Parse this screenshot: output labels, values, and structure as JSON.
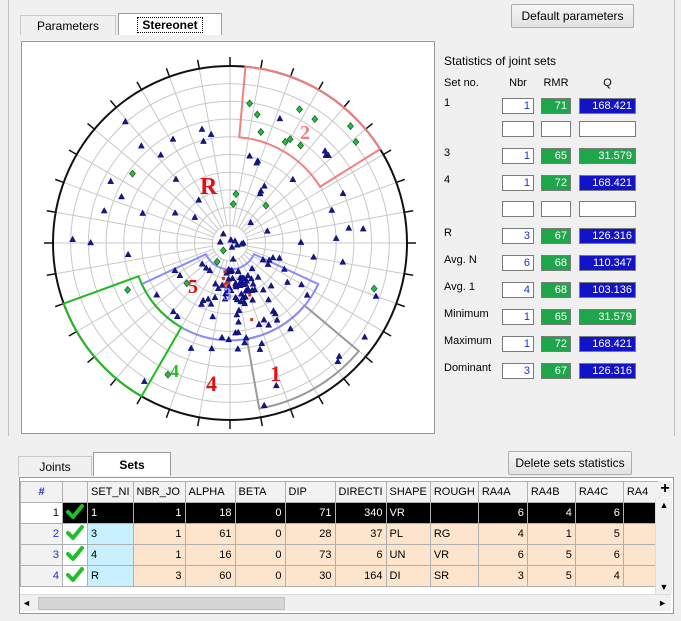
{
  "top_tabs": {
    "parameters": "Parameters",
    "stereonet": "Stereonet"
  },
  "default_button": "Default parameters",
  "stats": {
    "title": "Statistics of joint sets",
    "col_set": "Set no.",
    "col_nbr": "Nbr",
    "col_rmr": "RMR",
    "col_q": "Q",
    "rows": [
      {
        "label": "1",
        "nbr": "1",
        "rmr": "71",
        "q": "168.421",
        "qcolor": "blue"
      },
      {
        "label": "",
        "nbr": "",
        "rmr": "",
        "q": "",
        "qcolor": "empty"
      },
      {
        "label": "3",
        "nbr": "1",
        "rmr": "65",
        "q": "31.579",
        "qcolor": "green"
      },
      {
        "label": "4",
        "nbr": "1",
        "rmr": "72",
        "q": "168.421",
        "qcolor": "blue"
      },
      {
        "label": "",
        "nbr": "",
        "rmr": "",
        "q": "",
        "qcolor": "empty"
      },
      {
        "label": "R",
        "nbr": "3",
        "rmr": "67",
        "q": "126.316",
        "qcolor": "blue"
      },
      {
        "label": "Avg. N",
        "nbr": "6",
        "rmr": "68",
        "q": "110.347",
        "qcolor": "blue"
      },
      {
        "label": "Avg. 1",
        "nbr": "4",
        "rmr": "68",
        "q": "103.136",
        "qcolor": "blue"
      },
      {
        "label": "Minimum",
        "nbr": "1",
        "rmr": "65",
        "q": "31.579",
        "qcolor": "green"
      },
      {
        "label": "Maximum",
        "nbr": "1",
        "rmr": "72",
        "q": "168.421",
        "qcolor": "blue"
      },
      {
        "label": "Dominant",
        "nbr": "3",
        "rmr": "67",
        "q": "126.316",
        "qcolor": "blue"
      }
    ]
  },
  "stereonet": {
    "labels": {
      "set1": "1",
      "set2": "2",
      "set3": "3",
      "set3b": "5",
      "set4": "4",
      "set4b": "4",
      "random": "R"
    },
    "colors": {
      "set1": "#999999",
      "set2": "#f08080",
      "set3": "#8a8aff",
      "set4": "#22bb22",
      "label_red": "#e01010"
    }
  },
  "bottom_tabs": {
    "joints": "Joints",
    "sets": "Sets"
  },
  "delete_button": "Delete sets statistics",
  "grid": {
    "headers": [
      "#",
      "",
      "SET_NI",
      "NBR_JO",
      "ALPHA",
      "BETA",
      "DIP",
      "DIRECTI",
      "SHAPE",
      "ROUGH",
      "RA4A",
      "RA4B",
      "RA4C",
      "RA4"
    ],
    "rows": [
      {
        "n": "1",
        "set": "1",
        "nbr": "1",
        "alpha": "18",
        "beta": "0",
        "dip": "71",
        "dir": "340",
        "shape": "VR",
        "rough": "",
        "ra4a": "6",
        "ra4b": "4",
        "ra4c": "6",
        "ra4d": "",
        "selected": true
      },
      {
        "n": "2",
        "set": "3",
        "nbr": "1",
        "alpha": "61",
        "beta": "0",
        "dip": "28",
        "dir": "37",
        "shape": "PL",
        "rough": "RG",
        "ra4a": "4",
        "ra4b": "1",
        "ra4c": "5",
        "ra4d": "",
        "selected": false
      },
      {
        "n": "3",
        "set": "4",
        "nbr": "1",
        "alpha": "16",
        "beta": "0",
        "dip": "73",
        "dir": "6",
        "shape": "UN",
        "rough": "VR",
        "ra4a": "6",
        "ra4b": "5",
        "ra4c": "6",
        "ra4d": "",
        "selected": false
      },
      {
        "n": "4",
        "set": "R",
        "nbr": "3",
        "alpha": "60",
        "beta": "0",
        "dip": "30",
        "dir": "164",
        "shape": "DI",
        "rough": "SR",
        "ra4a": "3",
        "ra4b": "5",
        "ra4c": "4",
        "ra4d": "",
        "selected": false
      }
    ]
  },
  "scroll": {
    "up": "▲",
    "down": "▼",
    "left": "◄",
    "right": "►",
    "plus": "+"
  }
}
